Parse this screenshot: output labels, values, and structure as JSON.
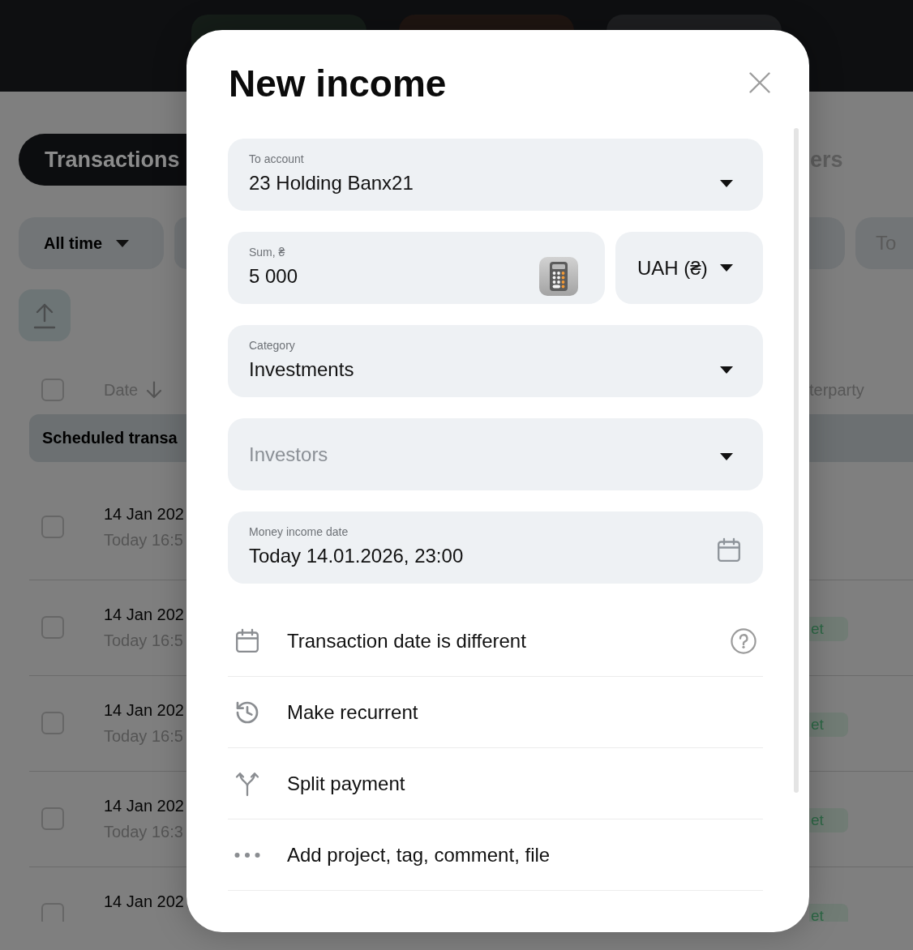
{
  "top_bar": {
    "buttons": [
      {
        "color": "#151d18"
      },
      {
        "color": "#1f1511"
      },
      {
        "color": "#1e1f21"
      }
    ]
  },
  "page": {
    "tabs": [
      {
        "label": "Transactions",
        "selected": true
      },
      {
        "label": "ers",
        "selected": false
      }
    ],
    "period_filter": {
      "value": "All time"
    },
    "to_filter": {
      "placeholder": "To"
    },
    "table": {
      "header_checkbox": {
        "checked": false
      },
      "columns": [
        {
          "label": "Date",
          "sorted_descending": true
        },
        {
          "label": "terparty"
        }
      ],
      "group": {
        "label": "Scheduled transa"
      },
      "rows": [
        {
          "checked": false,
          "date": "14 Jan 202",
          "time": "Today 16:5"
        },
        {
          "checked": false,
          "date": "14 Jan 202",
          "time": "Today 16:5",
          "badge": "et"
        },
        {
          "checked": false,
          "date": "14 Jan 202",
          "time": "Today 16:5",
          "badge": "et"
        },
        {
          "checked": false,
          "date": "14 Jan 202",
          "time": "Today 16:3",
          "badge": "et"
        },
        {
          "checked": false,
          "date": "14 Jan 202",
          "badge": "et"
        }
      ]
    }
  },
  "modal": {
    "title": "New income",
    "fields": [
      {
        "kind": "select",
        "label": "To account",
        "value": "23 Holding Banx21"
      },
      {
        "kind": "amount",
        "label": "Sum, ₴",
        "value": "5 000",
        "currency": "UAH (₴)"
      },
      {
        "kind": "select",
        "label": "Category",
        "value": "Investments"
      },
      {
        "kind": "select",
        "placeholder": "Investors"
      },
      {
        "kind": "date",
        "label": "Money income date",
        "value": "Today 14.01.2026, 23:00"
      }
    ],
    "options": [
      {
        "kind": "calendar",
        "label": "Transaction date is different",
        "help": true
      },
      {
        "kind": "recurrent",
        "label": "Make recurrent",
        "help": false
      },
      {
        "kind": "split",
        "label": "Split payment",
        "help": false
      },
      {
        "kind": "more",
        "label": "Add project, tag, comment, file",
        "help": false
      }
    ]
  }
}
